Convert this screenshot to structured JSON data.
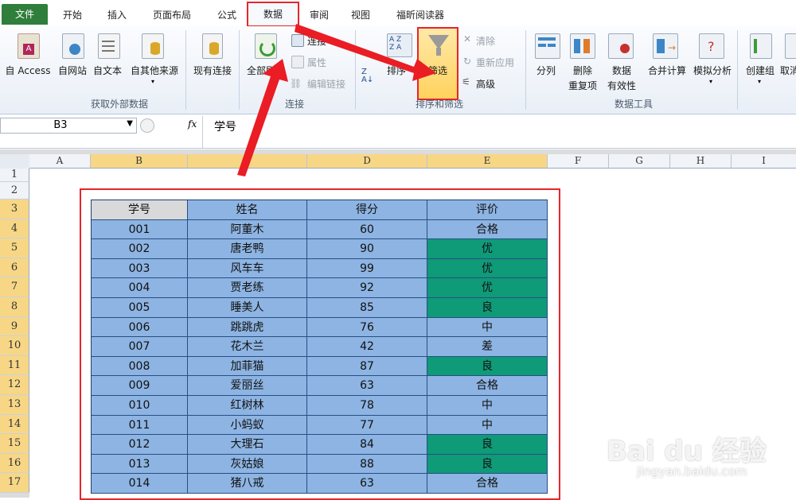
{
  "tabs": [
    "文件",
    "开始",
    "插入",
    "页面布局",
    "公式",
    "数据",
    "审阅",
    "视图",
    "福昕阅读器"
  ],
  "active_tab": "数据",
  "ribbon": {
    "get_external": {
      "access": "自 Access",
      "web": "自网站",
      "text": "自文本",
      "other": "自其他来源",
      "existing": "现有连接",
      "label": "获取外部数据"
    },
    "connections": {
      "refresh_all": "全部刷新",
      "connections": "连接",
      "properties": "属性",
      "edit_links": "编辑链接",
      "label": "连接"
    },
    "sort_filter": {
      "sort": "排序",
      "filter": "筛选",
      "clear": "清除",
      "reapply": "重新应用",
      "advanced": "高级",
      "label": "排序和筛选"
    },
    "data_tools": {
      "split": "分列",
      "remove_dup_1": "删除",
      "remove_dup_2": "重复项",
      "validation_1": "数据",
      "validation_2": "有效性",
      "consolidate": "合并计算",
      "what_if": "模拟分析",
      "label": "数据工具"
    },
    "outline": {
      "group": "创建组",
      "ungroup": "取消"
    }
  },
  "formula_bar": {
    "name_box": "B3",
    "fx": "fx",
    "content": "学号"
  },
  "columns": [
    "A",
    "B",
    "C",
    "D",
    "E",
    "F",
    "G",
    "H",
    "I"
  ],
  "rows": [
    "1",
    "2",
    "3",
    "4",
    "5",
    "6",
    "7",
    "8",
    "9",
    "10",
    "11",
    "12",
    "13",
    "14",
    "15",
    "16",
    "17"
  ],
  "table": {
    "headers": [
      "学号",
      "姓名",
      "得分",
      "评价"
    ],
    "rows": [
      [
        "001",
        "阿董木",
        "60",
        "合格"
      ],
      [
        "002",
        "唐老鸭",
        "90",
        "优"
      ],
      [
        "003",
        "风车车",
        "99",
        "优"
      ],
      [
        "004",
        "贾老练",
        "92",
        "优"
      ],
      [
        "005",
        "睡美人",
        "85",
        "良"
      ],
      [
        "006",
        "跳跳虎",
        "76",
        "中"
      ],
      [
        "007",
        "花木兰",
        "42",
        "差"
      ],
      [
        "008",
        "加菲猫",
        "87",
        "良"
      ],
      [
        "009",
        "爱丽丝",
        "63",
        "合格"
      ],
      [
        "010",
        "红树林",
        "78",
        "中"
      ],
      [
        "011",
        "小蚂蚁",
        "77",
        "中"
      ],
      [
        "012",
        "大理石",
        "84",
        "良"
      ],
      [
        "013",
        "灰姑娘",
        "88",
        "良"
      ],
      [
        "014",
        "猪八戒",
        "63",
        "合格"
      ]
    ],
    "highlight_color": "#0f9a78",
    "cell_color": "#8db4e2"
  },
  "watermark": {
    "brand": "Bai du 经验",
    "url": "jingyan.baidu.com"
  }
}
